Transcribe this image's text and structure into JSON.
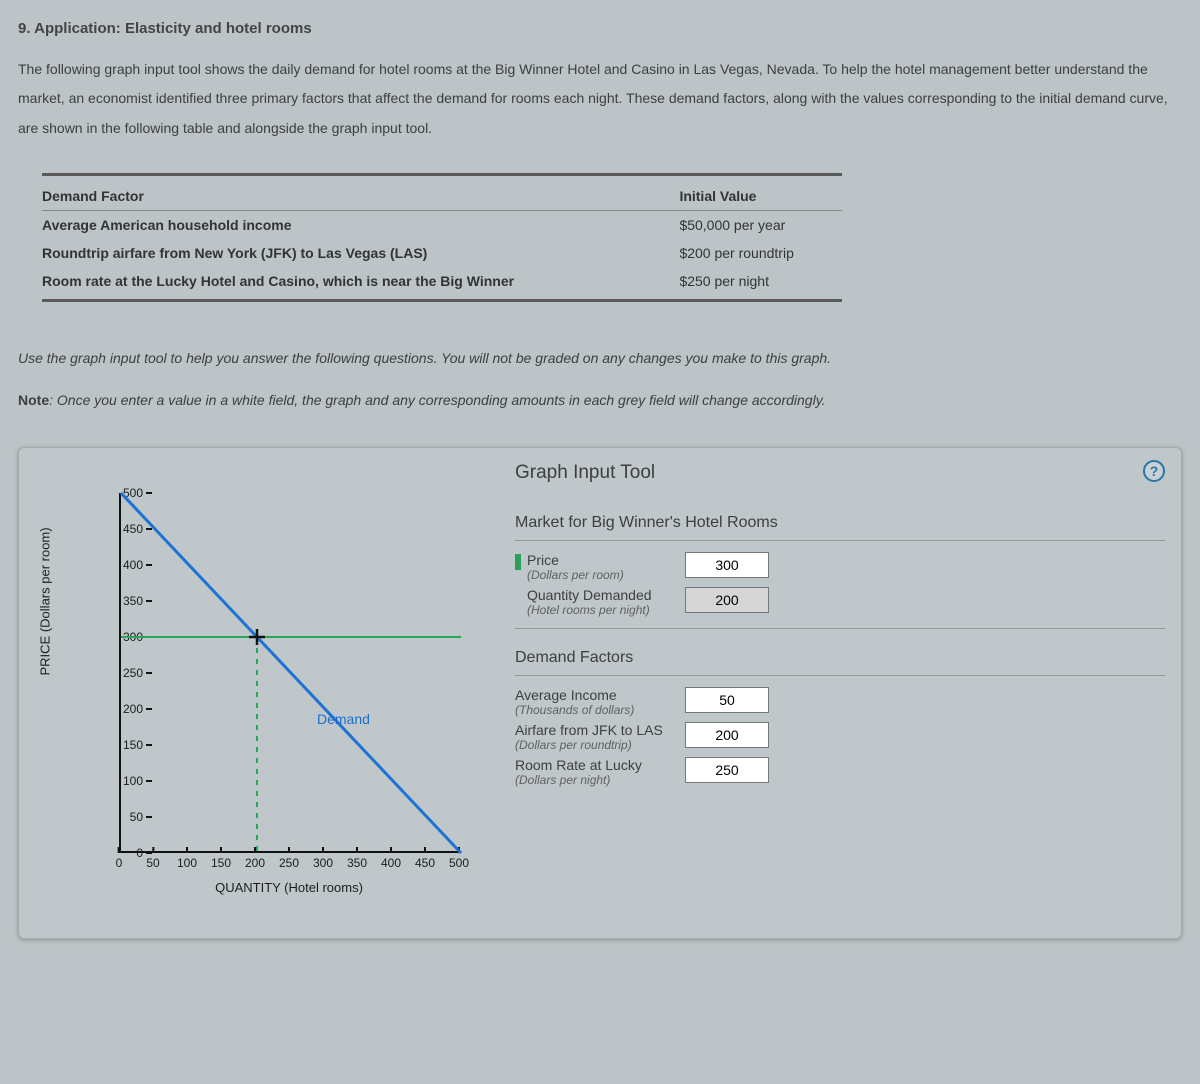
{
  "question": {
    "number_title": "9. Application: Elasticity and hotel rooms",
    "intro": "The following graph input tool shows the daily demand for hotel rooms at the Big Winner Hotel and Casino in Las Vegas, Nevada. To help the hotel management better understand the market, an economist identified three primary factors that affect the demand for rooms each night. These demand factors, along with the values corresponding to the initial demand curve, are shown in the following table and alongside the graph input tool."
  },
  "factor_table": {
    "headers": {
      "factor": "Demand Factor",
      "value": "Initial Value"
    },
    "rows": [
      {
        "factor": "Average American household income",
        "value": "$50,000 per year"
      },
      {
        "factor": "Roundtrip airfare from New York (JFK) to Las Vegas (LAS)",
        "value": "$200 per roundtrip"
      },
      {
        "factor": "Room rate at the Lucky Hotel and Casino, which is near the Big Winner",
        "value": "$250 per night"
      }
    ]
  },
  "instructions": {
    "line1": "Use the graph input tool to help you answer the following questions. You will not be graded on any changes you make to this graph.",
    "note_label": "Note",
    "note_text": ": Once you enter a value in a white field, the graph and any corresponding amounts in each grey field will change accordingly."
  },
  "tool": {
    "title": "Graph Input Tool",
    "help": "?",
    "market_section": "Market for Big Winner's Hotel Rooms",
    "price": {
      "label": "Price",
      "sub": "(Dollars per room)",
      "value": "300"
    },
    "quantity": {
      "label": "Quantity Demanded",
      "sub": "(Hotel rooms per night)",
      "value": "200"
    },
    "demand_section": "Demand Factors",
    "income": {
      "label": "Average Income",
      "sub": "(Thousands of dollars)",
      "value": "50"
    },
    "airfare": {
      "label": "Airfare from JFK to LAS",
      "sub": "(Dollars per roundtrip)",
      "value": "200"
    },
    "lucky": {
      "label": "Room Rate at Lucky",
      "sub": "(Dollars per night)",
      "value": "250"
    }
  },
  "chart_data": {
    "type": "line",
    "title": "",
    "xlabel": "QUANTITY (Hotel rooms)",
    "ylabel": "PRICE (Dollars per room)",
    "xlim": [
      0,
      500
    ],
    "ylim": [
      0,
      500
    ],
    "x_ticks": [
      0,
      50,
      100,
      150,
      200,
      250,
      300,
      350,
      400,
      450,
      500
    ],
    "y_ticks": [
      0,
      50,
      100,
      150,
      200,
      250,
      300,
      350,
      400,
      450,
      500
    ],
    "series": [
      {
        "name": "Demand",
        "x": [
          0,
          500
        ],
        "y": [
          500,
          0
        ],
        "color": "#1c72d6"
      }
    ],
    "marker": {
      "x": 200,
      "y": 300
    },
    "guide_h": {
      "y": 300,
      "x_from": 0,
      "x_to": 500
    },
    "guide_v": {
      "x": 200,
      "y_from": 0,
      "y_to": 300
    },
    "legend_label": "Demand"
  }
}
